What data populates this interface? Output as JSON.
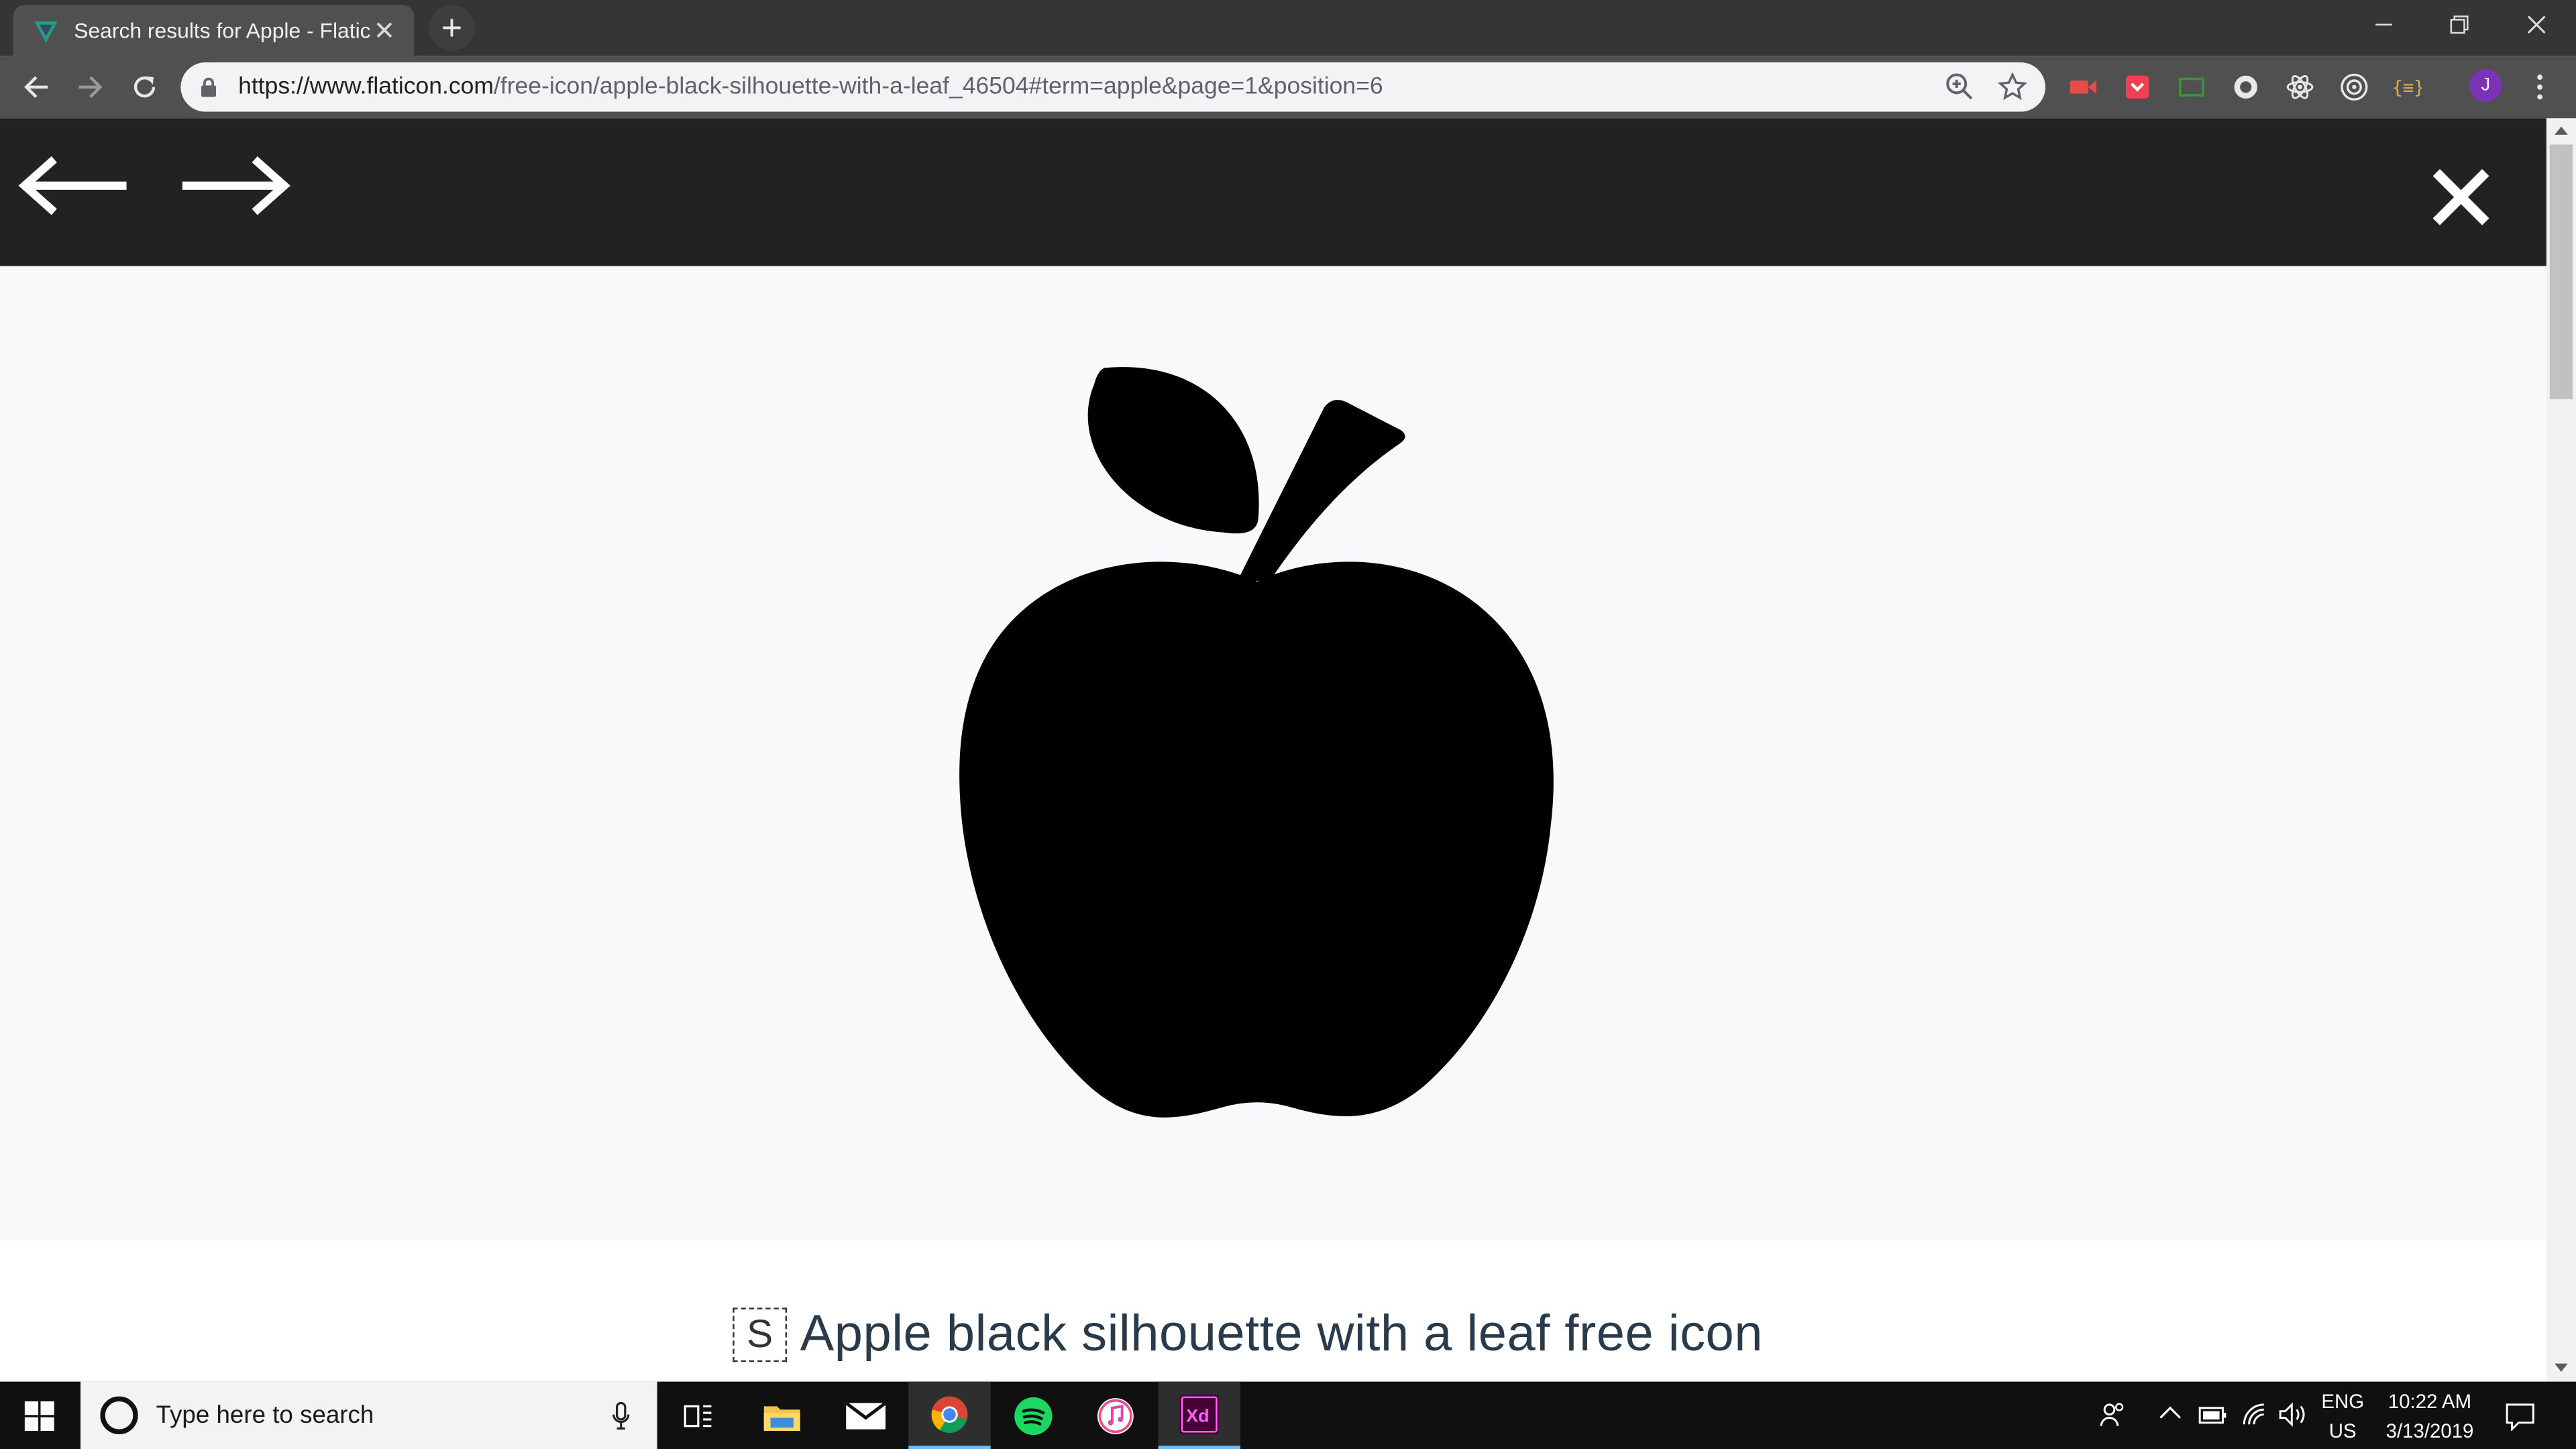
{
  "browser": {
    "tab_title": "Search results for Apple - Flaticon",
    "url_host": "https://www.flaticon.com",
    "url_path": "/free-icon/apple-black-silhouette-with-a-leaf_46504#term=apple&page=1&position=6",
    "profile_initial": "J"
  },
  "page": {
    "icon_badge": "S",
    "icon_title": "Apple black silhouette with a leaf free icon"
  },
  "taskbar": {
    "search_placeholder": "Type here to search",
    "language": "ENG",
    "region": "US",
    "time": "10:22 AM",
    "date": "3/13/2019"
  },
  "colors": {
    "tabstrip": "#353535",
    "toolbar": "#505050",
    "viewer_bar": "#222222",
    "stage": "#f8f9fb",
    "title_text": "#293b4a"
  }
}
